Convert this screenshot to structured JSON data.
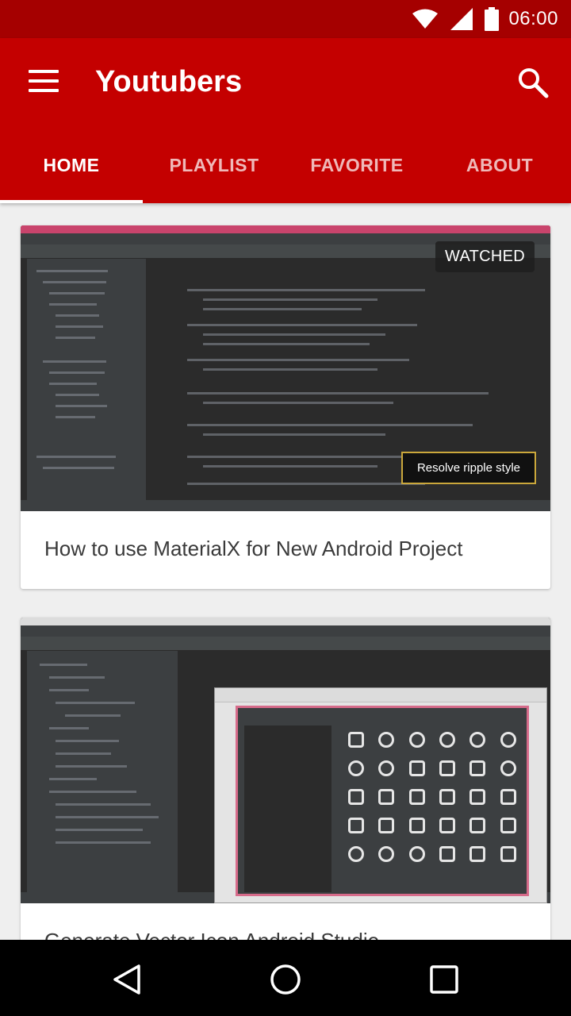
{
  "status_bar": {
    "time": "06:00",
    "icons": [
      "wifi-icon",
      "signal-icon",
      "battery-icon"
    ],
    "background": "#a50000"
  },
  "app_bar": {
    "title": "Youtubers",
    "menu_icon": "hamburger-menu-icon",
    "search_icon": "search-icon",
    "background": "#c40000"
  },
  "tabs": [
    {
      "label": "HOME",
      "active": true
    },
    {
      "label": "PLAYLIST",
      "active": false
    },
    {
      "label": "FAVORITE",
      "active": false
    },
    {
      "label": "ABOUT",
      "active": false
    }
  ],
  "cards": [
    {
      "title": "How to use MaterialX for New Android Project",
      "badge": "WATCHED",
      "overlay_text": "Resolve ripple style"
    },
    {
      "title": "Generate Vector Icon Android Studio"
    }
  ],
  "nav_bar": {
    "icons": [
      "back-icon",
      "home-icon",
      "recent-apps-icon"
    ]
  }
}
